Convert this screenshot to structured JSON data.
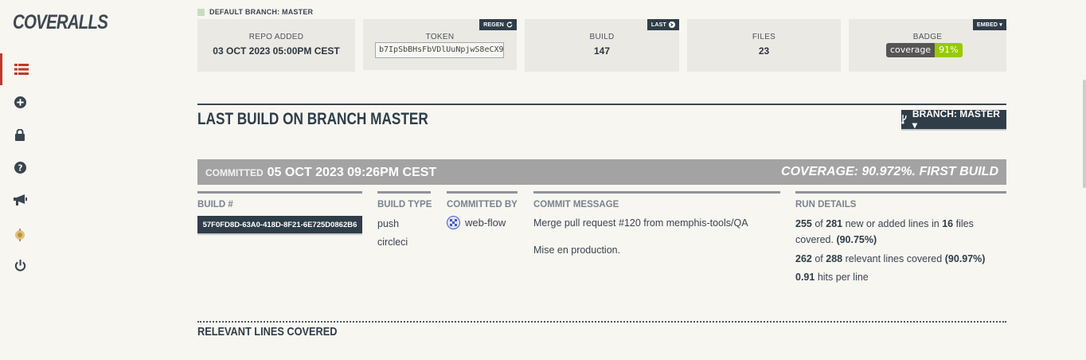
{
  "app": {
    "logo": "COVERALLS"
  },
  "sidebar": {
    "items": [
      {
        "icon": "list-icon",
        "active": true
      },
      {
        "icon": "plus-circle-icon"
      },
      {
        "icon": "lock-icon"
      },
      {
        "icon": "question-circle-icon"
      },
      {
        "icon": "bullhorn-icon"
      },
      {
        "icon": "badge-icon"
      },
      {
        "icon": "power-icon"
      }
    ]
  },
  "default_branch": "DEFAULT BRANCH: MASTER",
  "cards": {
    "repo_added": {
      "label": "REPO ADDED",
      "value": "03 OCT 2023 05:00PM CEST"
    },
    "token": {
      "label": "TOKEN",
      "value": "b7IpSbBHsFbVDlUuNpjwS8eCX9",
      "button": "REGEN"
    },
    "build": {
      "label": "BUILD",
      "value": "147",
      "button": "LAST"
    },
    "files": {
      "label": "FILES",
      "value": "23"
    },
    "badge": {
      "label": "BADGE",
      "button": "EMBED ▾",
      "left": "coverage",
      "right": "91%"
    }
  },
  "section": {
    "title": "LAST BUILD ON BRANCH MASTER",
    "branch_button": "BRANCH: MASTER ▾"
  },
  "commit_bar": {
    "committed_label": "COMMITTED",
    "date": "05 OCT 2023 09:26PM CEST",
    "coverage": "COVERAGE: 90.972%. FIRST BUILD"
  },
  "details": {
    "build_number": {
      "head": "BUILD #",
      "value": "57F0FD8D-63A0-418D-8F21-6E725D0862B6"
    },
    "build_type": {
      "head": "BUILD TYPE",
      "values": [
        "push",
        "circleci"
      ]
    },
    "committed_by": {
      "head": "COMMITTED BY",
      "value": "web-flow"
    },
    "commit_message": {
      "head": "COMMIT MESSAGE",
      "line1": "Merge pull request #120 from memphis-tools/QA",
      "line2": "Mise en production."
    },
    "run_details": {
      "head": "RUN DETAILS",
      "new_covered": "255",
      "new_total": "281",
      "new_text": "new or added lines in",
      "files": "16",
      "files_text": "files",
      "covered_text": "covered.",
      "new_pct": "(90.75%)",
      "rel_covered": "262",
      "rel_total": "288",
      "rel_text": "relevant lines covered",
      "rel_pct": "(90.97%)",
      "hits": "0.91",
      "hits_text": "hits per line",
      "of": "of"
    }
  },
  "bottom": {
    "title": "RELEVANT LINES COVERED"
  },
  "colors": {
    "accent": "#c0392b",
    "dark": "#2f3d49",
    "badge_green": "#97ca00"
  }
}
